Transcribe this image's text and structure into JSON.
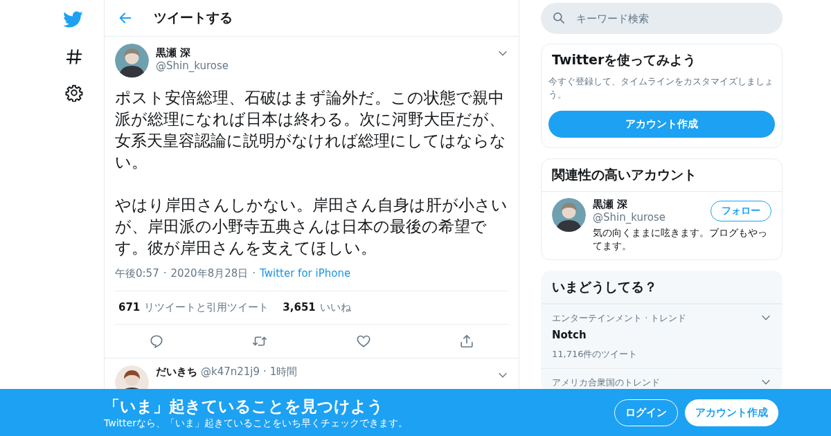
{
  "header": {
    "title": "ツイートする"
  },
  "tweet": {
    "name": "黒瀬 深",
    "handle": "@Shin_kurose",
    "paragraphs": [
      "ポスト安倍総理、石破はまず論外だ。この状態で親中派が総理になれば日本は終わる。次に河野大臣だが、女系天皇容認論に説明がなければ総理にしてはならない。",
      "やはり岸田さんしかない。岸田さん自身は肝が小さいが、岸田派の小野寺五典さんは日本の最後の希望です。彼が岸田さんを支えてほしい。"
    ],
    "meta": [
      {
        "kind": "text",
        "text": "午後0:57"
      },
      {
        "kind": "sep",
        "text": "·"
      },
      {
        "kind": "text",
        "text": "2020年8月28日"
      },
      {
        "kind": "sep",
        "text": "·"
      },
      {
        "kind": "link",
        "text": "Twitter for iPhone"
      }
    ],
    "stats": [
      {
        "count": "671",
        "label": "リツイートと引用ツイート"
      },
      {
        "count": "3,651",
        "label": "いいね"
      }
    ]
  },
  "replies": [
    {
      "name": "だいきち",
      "handle": "@k47n21j9",
      "sep": "·",
      "time": "1時間"
    }
  ],
  "search": {
    "placeholder": "キーワード検索"
  },
  "signup_card": {
    "title": "Twitterを使ってみよう",
    "text": "今すぐ登録して、タイムラインをカスタマイズしましょう。",
    "button": "アカウント作成"
  },
  "related": {
    "title": "関連性の高いアカウント",
    "accounts": [
      {
        "name": "黒瀬 深",
        "handle": "@Shin_kurose",
        "button": "フォロー",
        "bio": "気の向くままに呟きます。ブログもやってます。"
      }
    ]
  },
  "trends": {
    "title": "いまどうしてる？",
    "items": [
      {
        "context": "エンターテインメント · トレンド",
        "name": "Notch",
        "count": "11,716件のツイート"
      },
      {
        "context": "アメリカ合衆国のトレンド"
      }
    ]
  },
  "banner": {
    "title": "「いま」起きていることを見つけよう",
    "text": "Twitterなら、「いま」起きていることをいち早くチェックできます。",
    "buttons": [
      {
        "label": "ログイン",
        "kind": "outline"
      },
      {
        "label": "アカウント作成",
        "kind": "filled"
      }
    ]
  }
}
